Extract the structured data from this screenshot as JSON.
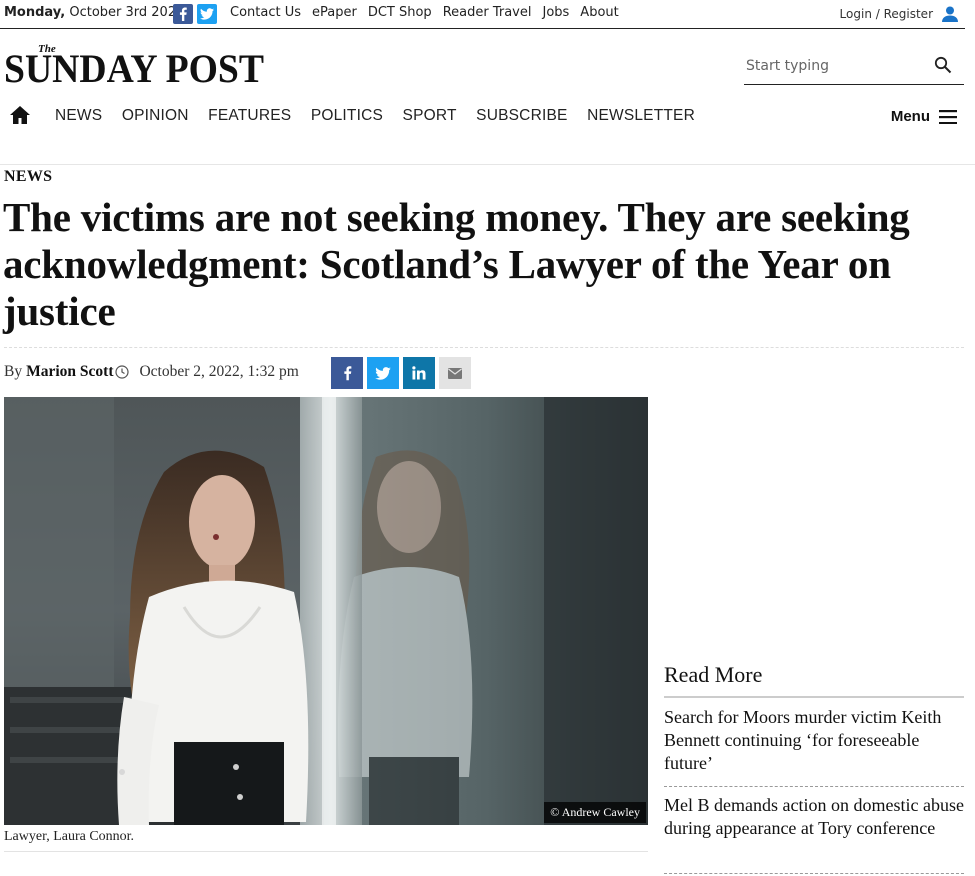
{
  "topbar": {
    "date_day": "Monday,",
    "date_rest": " October 3rd 2022",
    "links": [
      "Contact Us",
      "ePaper",
      "DCT Shop",
      "Reader Travel",
      "Jobs",
      "About"
    ],
    "login": "Login / Register"
  },
  "masthead": {
    "logo_the": "The",
    "logo_text": "SUNDAY POST"
  },
  "search": {
    "placeholder": "Start typing"
  },
  "nav": {
    "items": [
      "NEWS",
      "OPINION",
      "FEATURES",
      "POLITICS",
      "SPORT",
      "SUBSCRIBE",
      "NEWSLETTER"
    ],
    "menu": "Menu"
  },
  "article": {
    "kicker": "NEWS",
    "headline": "The victims are not seeking money. They are seeking acknowledgment: Scotland’s Lawyer of the Year on justice",
    "by": "By",
    "author": "Marion Scott",
    "date": "October 2, 2022, 1:32 pm",
    "image_credit": "© Andrew Cawley",
    "caption": "Lawyer, Laura Connor."
  },
  "share_icons": [
    "facebook-icon",
    "twitter-icon",
    "linkedin-icon",
    "email-icon"
  ],
  "read_more": {
    "title": "Read More",
    "items": [
      "Search for Moors murder victim Keith Bennett continuing ‘for foreseeable future’",
      "Mel B demands action on domestic abuse during appearance at Tory conference"
    ]
  },
  "colors": {
    "facebook": "#3b5998",
    "twitter": "#1da1f2",
    "linkedin": "#0e76a8",
    "login_icon": "#1a73c8"
  }
}
